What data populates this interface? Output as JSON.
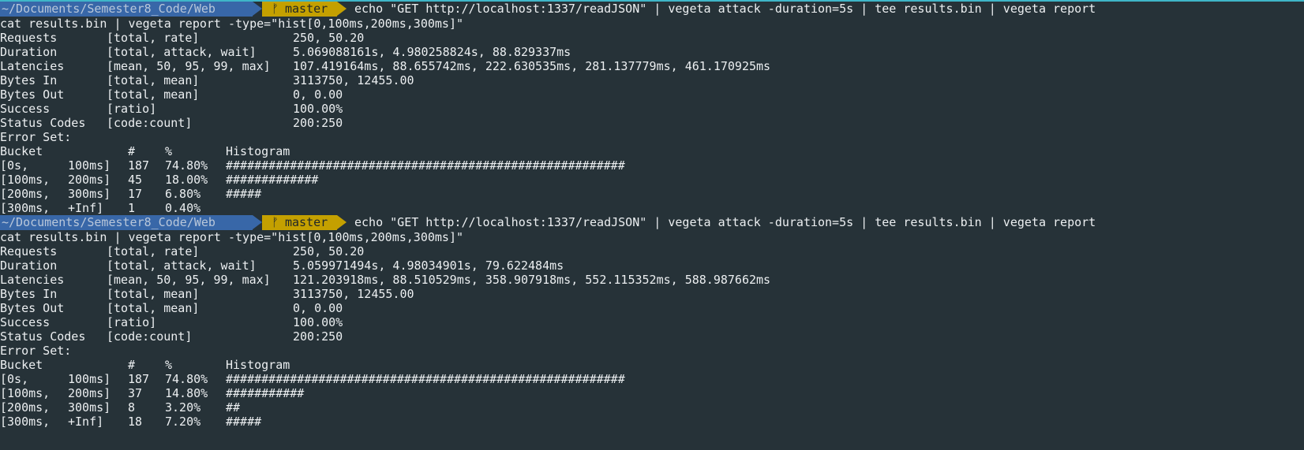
{
  "prompt": {
    "path": "~/Documents/Semester8_Code/Web",
    "branch_icon": "git-branch-icon",
    "branch_glyph": "ᚠ",
    "branch": "master",
    "command": "echo \"GET http://localhost:1337/readJSON\" | vegeta attack -duration=5s | tee results.bin | vegeta report",
    "colors": {
      "background": "#263238",
      "path_segment": "#3867a8",
      "git_segment": "#c4a000",
      "top_accent": "#3fb6c8"
    }
  },
  "command2": "cat results.bin | vegeta report -type=\"hist[0,100ms,200ms,300ms]\"",
  "metric_labels": {
    "requests": "Requests",
    "duration": "Duration",
    "latencies": "Latencies",
    "bytes_in": "Bytes In",
    "bytes_out": "Bytes Out",
    "success": "Success",
    "status_codes": "Status Codes"
  },
  "metric_fields": {
    "requests": "[total, rate]",
    "duration": "[total, attack, wait]",
    "latencies": "[mean, 50, 95, 99, max]",
    "bytes_in": "[total, mean]",
    "bytes_out": "[total, mean]",
    "success": "[ratio]",
    "status_codes": "[code:count]"
  },
  "error_set_label": "Error Set:",
  "hist_header": {
    "bucket": "Bucket",
    "count": "#",
    "percent": "%",
    "histogram": "Histogram"
  },
  "runs": [
    {
      "metrics": {
        "requests": "250, 50.20",
        "duration": "5.069088161s, 4.980258824s, 88.829337ms",
        "latencies": "107.419164ms, 88.655742ms, 222.630535ms, 281.137779ms, 461.170925ms",
        "bytes_in": "3113750, 12455.00",
        "bytes_out": "0, 0.00",
        "success": "100.00%",
        "status_codes": "200:250"
      },
      "buckets": [
        {
          "lower": "[0s,",
          "upper": "100ms]",
          "count": "187",
          "percent": "74.80%",
          "bar": "########################################################"
        },
        {
          "lower": "[100ms,",
          "upper": "200ms]",
          "count": "45",
          "percent": "18.00%",
          "bar": "#############"
        },
        {
          "lower": "[200ms,",
          "upper": "300ms]",
          "count": "17",
          "percent": "6.80%",
          "bar": "#####"
        },
        {
          "lower": "[300ms,",
          "upper": "+Inf]",
          "count": "1",
          "percent": "0.40%",
          "bar": ""
        }
      ]
    },
    {
      "metrics": {
        "requests": "250, 50.20",
        "duration": "5.059971494s, 4.98034901s, 79.622484ms",
        "latencies": "121.203918ms, 88.510529ms, 358.907918ms, 552.115352ms, 588.987662ms",
        "bytes_in": "3113750, 12455.00",
        "bytes_out": "0, 0.00",
        "success": "100.00%",
        "status_codes": "200:250"
      },
      "buckets": [
        {
          "lower": "[0s,",
          "upper": "100ms]",
          "count": "187",
          "percent": "74.80%",
          "bar": "########################################################"
        },
        {
          "lower": "[100ms,",
          "upper": "200ms]",
          "count": "37",
          "percent": "14.80%",
          "bar": "###########"
        },
        {
          "lower": "[200ms,",
          "upper": "300ms]",
          "count": "8",
          "percent": "3.20%",
          "bar": "##"
        },
        {
          "lower": "[300ms,",
          "upper": "+Inf]",
          "count": "18",
          "percent": "7.20%",
          "bar": "#####"
        }
      ]
    }
  ]
}
